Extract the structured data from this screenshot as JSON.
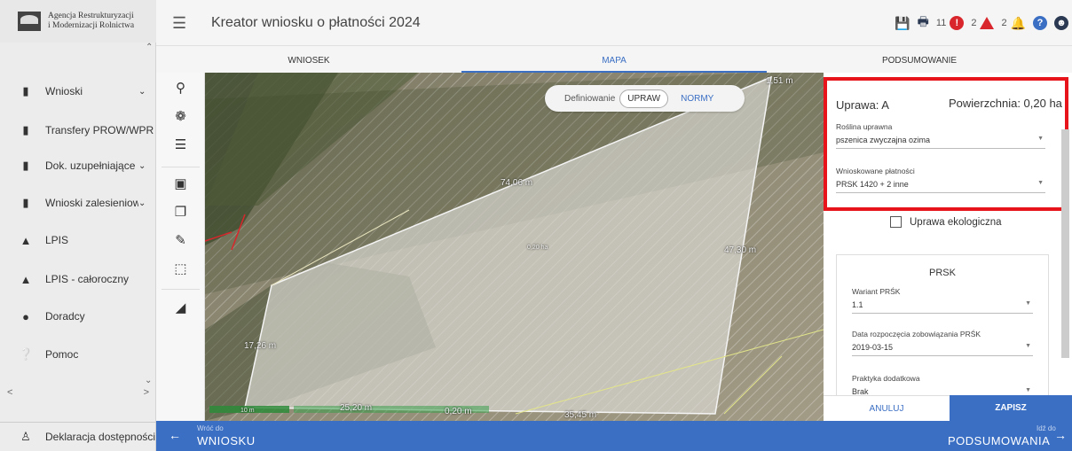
{
  "app": {
    "logo_line1": "Agencja Restrukturyzacji",
    "logo_line2": "i Modernizacji Rolnictwa",
    "title": "Kreator wniosku o płatności 2024"
  },
  "header": {
    "count_errors": "11",
    "count_warnings": "2",
    "count_notifications": "2"
  },
  "sidebar": {
    "items": [
      {
        "label": "Wnioski",
        "icon": "document-icon",
        "has_chevron": true
      },
      {
        "label": "Transfery PROW/WPR",
        "icon": "document-icon",
        "has_chevron": false
      },
      {
        "label": "Dok. uzupełniające",
        "icon": "document-icon",
        "has_chevron": true
      },
      {
        "label": "Wnioski zalesieniowe",
        "icon": "document-icon",
        "has_chevron": true
      },
      {
        "label": "LPIS",
        "icon": "mountain-icon",
        "has_chevron": false
      },
      {
        "label": "LPIS - całoroczny",
        "icon": "mountain-icon",
        "has_chevron": false
      },
      {
        "label": "Doradcy",
        "icon": "user-icon",
        "has_chevron": false
      },
      {
        "label": "Pomoc",
        "icon": "help-icon",
        "has_chevron": false
      }
    ],
    "footer_label": "Deklaracja dostępności"
  },
  "tabs": [
    {
      "label": "WNIOSEK",
      "active": false
    },
    {
      "label": "MAPA",
      "active": true
    },
    {
      "label": "PODSUMOWANIE",
      "active": false
    }
  ],
  "map": {
    "toggle_label": "Definiowanie",
    "toggle_upraw": "UPRAW",
    "toggle_normy": "NORMY",
    "labels": {
      "top_right": "1,51 m",
      "top_mid": "74,06 m",
      "right_mid": "47,30 m",
      "area": "0,20 ha",
      "left_mid": "17,26 m",
      "bottom_left": "25,20 m",
      "bottom_mid": "0,20 m",
      "bottom_right": "35,45 m",
      "scale": "10 m"
    }
  },
  "panel": {
    "crop_title": "Uprawa: A",
    "area_title": "Powierzchnia: 0,20 ha",
    "plant_label": "Roślina uprawna",
    "plant_value": "pszenica zwyczajna ozima",
    "payments_label": "Wnioskowane płatności",
    "payments_value": "PRSK 1420 + 2 inne",
    "eco_label": "Uprawa ekologiczna",
    "prsk_title": "PRSK",
    "variant_label": "Wariant PRŚK",
    "variant_value": "1.1",
    "start_date_label": "Data rozpoczęcia zobowiązania PRŚK",
    "start_date_value": "2019-03-15",
    "extra_practice_label": "Praktyka dodatkowa",
    "extra_practice_value": "Brak",
    "cancel_label": "ANULUJ",
    "save_label": "ZAPISZ"
  },
  "bottom_nav": {
    "back_small": "Wróć do",
    "back_big": "WNIOSKU",
    "next_small": "Idź do",
    "next_big": "PODSUMOWANIA"
  },
  "colors": {
    "accent": "#3b6fc4",
    "highlight": "#e8141b",
    "error": "#d9262c"
  }
}
